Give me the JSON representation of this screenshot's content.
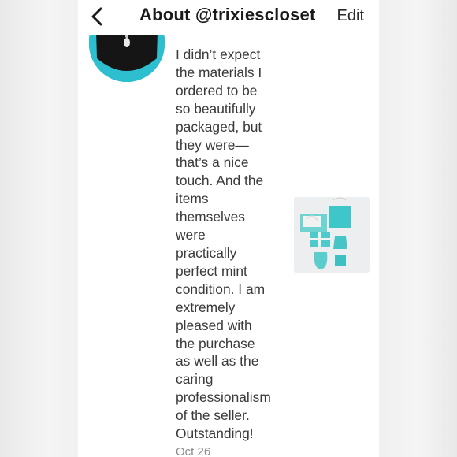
{
  "header": {
    "title": "About @trixiescloset",
    "edit_label": "Edit",
    "back_icon": "chevron-left-icon"
  },
  "review": {
    "text": "I didn’t expect\nthe materials I\nordered to be\nso beautifully\npackaged, but\nthey were—\nthat’s a nice\ntouch. And the\nitems\nthemselves\nwere\npractically\nperfect mint\ncondition. I am\nextremely\npleased with\nthe purchase\nas well as the\ncaring\nprofessionalism\nof the seller.\nOutstanding!",
    "date": "Oct 26"
  },
  "colors": {
    "accent_teal": "#2dbfcf",
    "text": "#3a3a3a",
    "muted": "#8a8a8a"
  }
}
